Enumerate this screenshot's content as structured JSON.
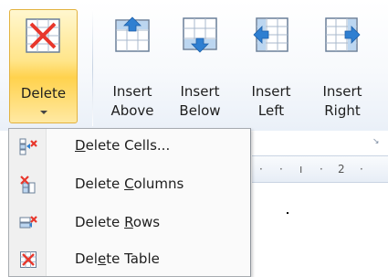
{
  "ribbon": {
    "delete_label": "Delete",
    "insert_above": {
      "line1": "Insert",
      "line2": "Above"
    },
    "insert_below": {
      "line1": "Insert",
      "line2": "Below"
    },
    "insert_left": {
      "line1": "Insert",
      "line2": "Left"
    },
    "insert_right": {
      "line1": "Insert",
      "line2": "Right"
    },
    "active_color": "#ffd24d",
    "delete_mark_color": "#e8372c",
    "arrow_color": "#2f7fd1"
  },
  "menu": {
    "items": [
      {
        "pre": "",
        "ul": "D",
        "post": "elete Cells...",
        "icon": "delete-cells-icon"
      },
      {
        "pre": "Delete ",
        "ul": "C",
        "post": "olumns",
        "icon": "delete-columns-icon"
      },
      {
        "pre": "Delete ",
        "ul": "R",
        "post": "ows",
        "icon": "delete-rows-icon"
      },
      {
        "pre": "Del",
        "ul": "e",
        "post": "te Table",
        "icon": "delete-table-icon"
      }
    ]
  },
  "ruler": {
    "tick_2": "2"
  }
}
